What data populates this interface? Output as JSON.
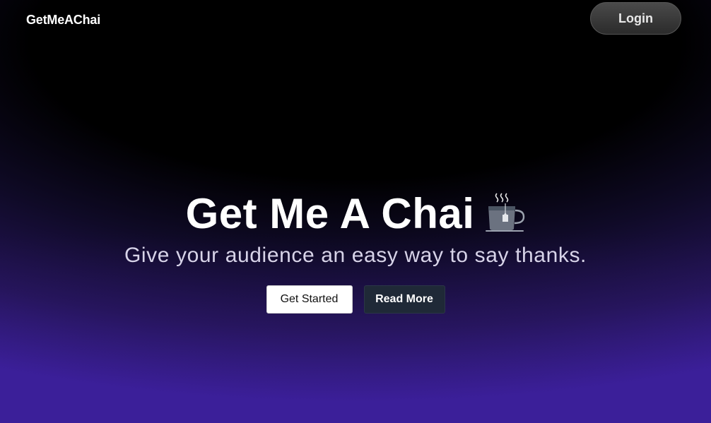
{
  "navbar": {
    "brand": "GetMeAChai",
    "login_label": "Login"
  },
  "hero": {
    "title": "Get Me A Chai",
    "icon": "tea-cup-icon",
    "subtitle": "Give your audience an easy way to say thanks.",
    "primary_label": "Get Started",
    "secondary_label": "Read More"
  },
  "colors": {
    "background_top": "#000000",
    "background_bottom": "#3b1f9a",
    "secondary_button": "#1f2937",
    "primary_button": "#ffffff"
  }
}
